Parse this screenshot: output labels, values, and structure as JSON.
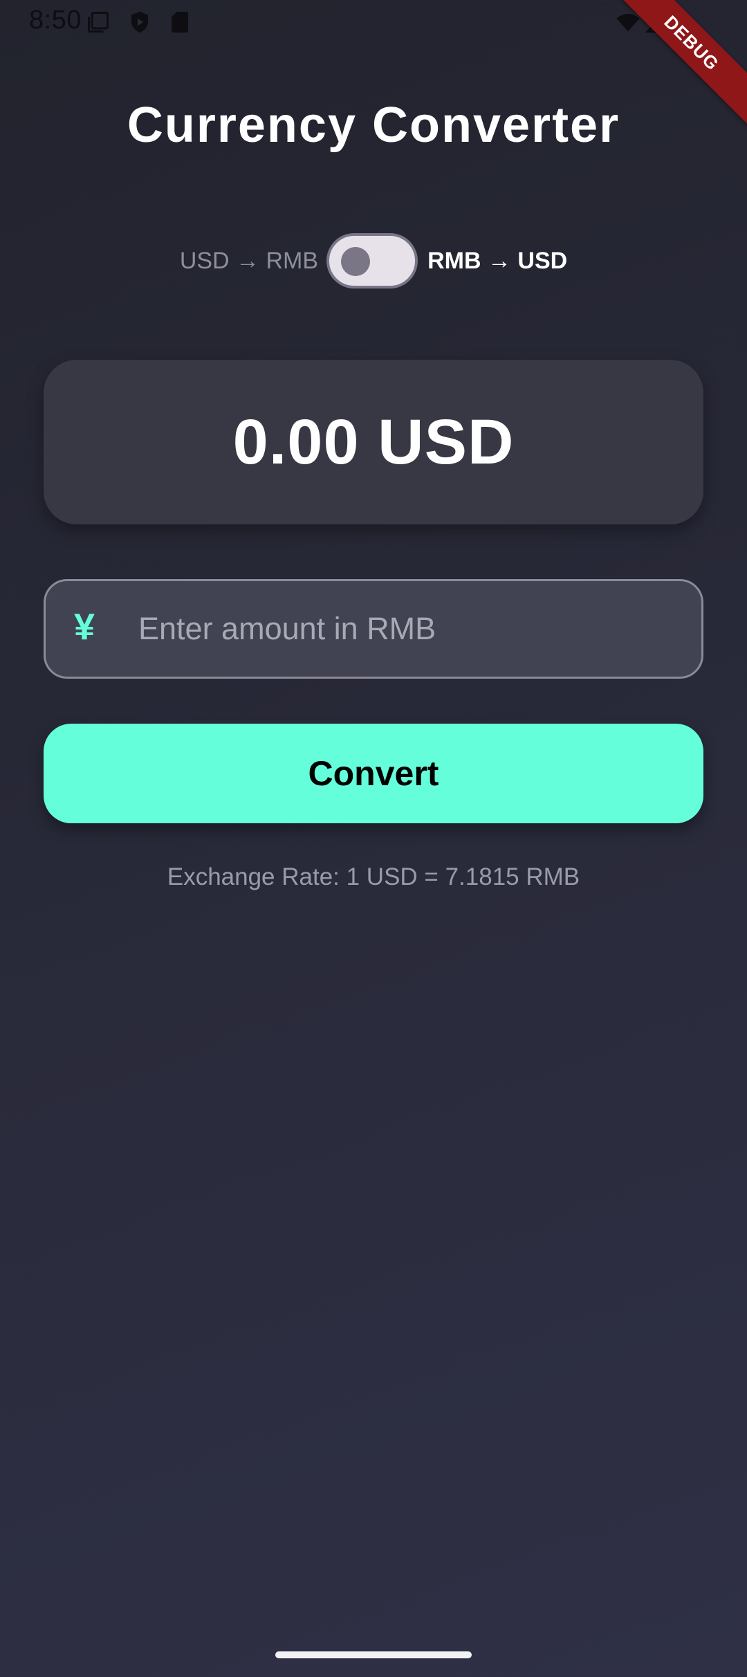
{
  "status_bar": {
    "time": "8:50",
    "left_icons": [
      "gallery-icon",
      "shield-play-icon",
      "sd-card-icon"
    ],
    "right_icons": [
      "wifi-icon",
      "cell-signal-icon"
    ]
  },
  "debug_banner": "DEBUG",
  "title": "Currency Converter",
  "toggle": {
    "left_label": "USD → RMB",
    "right_label": "RMB → USD",
    "on": false
  },
  "result": {
    "display": "0.00 USD"
  },
  "amount_input": {
    "placeholder": "Enter amount in RMB",
    "value": "",
    "prefix_icon": "¥"
  },
  "convert_button": {
    "label": "Convert"
  },
  "exchange_rate": "Exchange Rate: 1 USD = 7.1815 RMB",
  "colors": {
    "accent": "#64ffda",
    "background_top": "#22232d",
    "background_bottom": "#2f3046",
    "card": "#383844",
    "input_fill": "#414252",
    "debug_ribbon": "#8f1717"
  }
}
